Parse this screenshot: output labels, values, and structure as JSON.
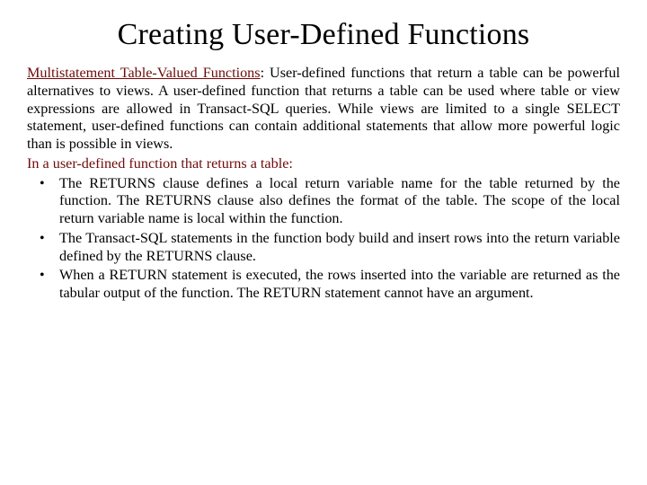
{
  "title": "Creating User-Defined Functions",
  "lead": "Multistatement Table-Valued Functions",
  "para1_rest": ": User-defined functions that return a table can be powerful alternatives to views. A user-defined function that returns a table can be used where table or view expressions are allowed in Transact-SQL queries. While views are limited to a single SELECT statement, user-defined functions can contain additional statements that allow more powerful logic than is possible in views.",
  "para2": "In a user-defined function that returns a table:",
  "bullets": [
    "The RETURNS clause defines a local return variable name for the table returned by the function. The RETURNS clause also defines the format of the table. The scope of the local return variable name is local within the function.",
    "The Transact-SQL statements in the function body build and insert rows into the return variable defined by the RETURNS clause.",
    "When a RETURN statement is executed, the rows inserted into the variable are returned as the tabular output of the function. The RETURN statement cannot have an argument."
  ]
}
